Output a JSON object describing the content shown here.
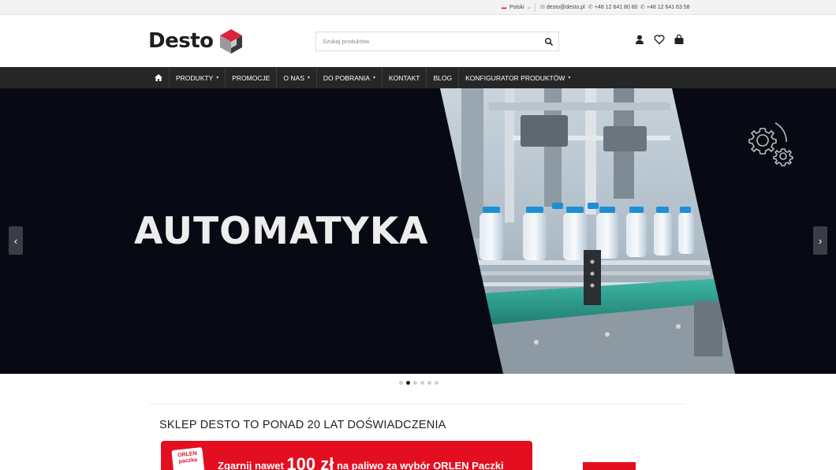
{
  "topbar": {
    "language": "Polski",
    "email": "desto@desto.pl",
    "phone1": "+48 12 641 80 80",
    "phone2": "+48 12 641 63 58"
  },
  "header": {
    "logo_text": "Desto",
    "search_placeholder": "Szukaj produktów"
  },
  "nav": {
    "items": [
      {
        "label": "PRODUKTY"
      },
      {
        "label": "PROMOCJE"
      },
      {
        "label": "O NAS"
      },
      {
        "label": "DO POBRANIA"
      },
      {
        "label": "KONTAKT"
      },
      {
        "label": "BLOG"
      },
      {
        "label": "KONFIGURATOR PRODUKTÓW"
      }
    ]
  },
  "hero": {
    "title": "AUTOMATYKA",
    "prev_label": "‹",
    "next_label": "›",
    "active_slide": 2,
    "slide_count": 6
  },
  "section": {
    "title": "SKLEP DESTO TO PONAD 20 LAT DOŚWIADCZENIA"
  },
  "banner": {
    "logo_line1": "ORLEN",
    "logo_line2": "paczka",
    "text_before": "Zgarnij nawet",
    "amount": "100 zł",
    "text_after": "na paliwo za wybór ORLEN Paczki"
  },
  "colors": {
    "nav_bg": "#262626",
    "hero_bg": "#070a12",
    "accent_red": "#e30f21"
  }
}
